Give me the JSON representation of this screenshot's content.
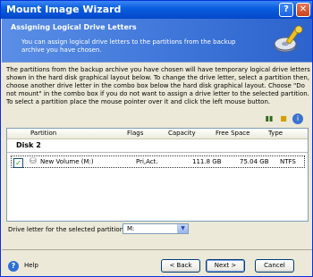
{
  "window": {
    "title": "Mount Image Wizard"
  },
  "header": {
    "title": "Assigning Logical Drive Letters",
    "subtitle": "You can assign logical drive letters to the partitions from the backup archive you have chosen."
  },
  "description": "The partitions from the backup archive you have chosen will have temporary logical drive letters shown in the hard disk graphical layout below. To change the drive letter, select a partition then, choose another drive letter in the combo box below the hard disk graphical layout. Choose \"Do not mount\" in the combo box if you do not want to assign a drive letter to the selected partition. To select a partition place the mouse pointer over it and click the left mouse button.",
  "table": {
    "columns": [
      "Partition",
      "Flags",
      "Capacity",
      "Free Space",
      "Type"
    ],
    "disk_label": "Disk 2",
    "rows": [
      {
        "partition": "New Volume (M:)",
        "flags": "Pri,Act.",
        "capacity": "111.8 GB",
        "free_space": "75.04 GB",
        "type": "NTFS",
        "checked": true
      }
    ]
  },
  "drive_letter": {
    "label": "Drive letter for the selected partition:",
    "value": "M:"
  },
  "footer": {
    "help": "Help",
    "back": "< Back",
    "next": "Next >",
    "cancel": "Cancel"
  }
}
